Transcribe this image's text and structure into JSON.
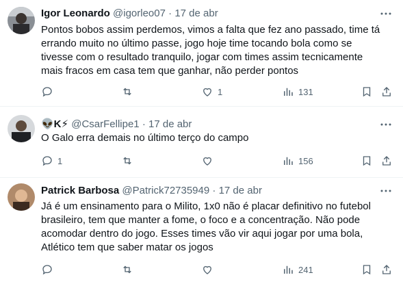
{
  "tweets": [
    {
      "author_name": "Igor Leonardo",
      "handle": "@igorleo07",
      "date": "17 de abr",
      "text": "Pontos bobos assim perdemos, vimos a falta que fez ano passado, time tá errando muito no último passe, jogo hoje time tocando bola como se tivesse com o resultado tranquilo, jogar com times assim tecnicamente mais fracos em casa tem que ganhar, não perder pontos",
      "replies": "",
      "retweets": "",
      "likes": "1",
      "views": "131"
    },
    {
      "author_name": "👽K⚡",
      "handle": "@CsarFellipe1",
      "date": "17 de abr",
      "text": "O Galo erra demais no último terço do campo",
      "replies": "1",
      "retweets": "",
      "likes": "",
      "views": "156"
    },
    {
      "author_name": "Patrick Barbosa",
      "handle": "@Patrick72735949",
      "date": "17 de abr",
      "text": "Já é um ensinamento para o Milito, 1x0 não é placar definitivo no futebol brasileiro, tem que manter a fome, o foco e a concentração. Não pode acomodar dentro do jogo. Esses times vão vir aqui jogar por uma bola, Atlético tem que saber matar os jogos",
      "replies": "",
      "retweets": "",
      "likes": "",
      "views": "241"
    }
  ],
  "separator": "·",
  "colors": {
    "text_primary": "#0f1419",
    "text_secondary": "#536471",
    "divider": "#eff3f4"
  },
  "icons": [
    "more-icon",
    "reply-icon",
    "retweet-icon",
    "like-icon",
    "views-icon",
    "bookmark-icon",
    "share-icon"
  ]
}
